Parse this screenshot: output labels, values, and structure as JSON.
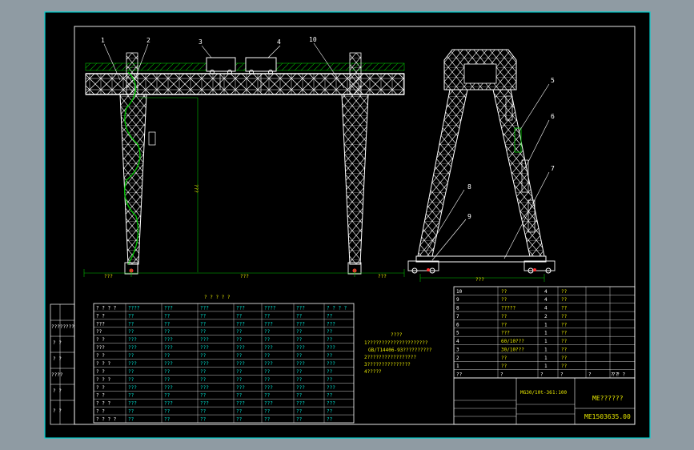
{
  "drawing": {
    "balloons_front": [
      "1",
      "2",
      "3",
      "4",
      "10"
    ],
    "balloons_side": [
      "5",
      "6",
      "7",
      "8",
      "9"
    ],
    "dims_front": [
      "???",
      "???",
      "???",
      "???"
    ],
    "dim_side": "???",
    "table_title": "? ? ? ? ?",
    "notes_title": "????",
    "notes_lines": [
      "1?????????????????????",
      "GB/T14406-93??????????",
      "2?????????????????",
      "3???????????????",
      "4?????"
    ],
    "left_margin_labels": [
      "????????",
      "? ?",
      "? ?",
      "????",
      "? ?",
      "? ?"
    ],
    "spec_rows": [
      [
        "? ? ? ?",
        "????",
        "???",
        "???",
        "???",
        "????",
        "???",
        "? ? ? ?"
      ],
      [
        "? ?",
        "??",
        "??",
        "??",
        "??",
        "??",
        "??",
        "??"
      ],
      [
        "???",
        "??",
        "??",
        "??",
        "???",
        "???",
        "???",
        "???"
      ],
      [
        "??",
        "??",
        "??",
        "??",
        "??",
        "??",
        "??",
        "??"
      ],
      [
        "? ?",
        "???",
        "???",
        "???",
        "??",
        "??",
        "??",
        "??"
      ],
      [
        "???",
        "???",
        "???",
        "???",
        "???",
        "???",
        "???",
        "???"
      ],
      [
        "? ?",
        "??",
        "??",
        "??",
        "??",
        "??",
        "??",
        "??"
      ],
      [
        "? ? ?",
        "???",
        "???",
        "???",
        "???",
        "???",
        "???",
        "???"
      ],
      [
        "? ?",
        "??",
        "??",
        "??",
        "??",
        "??",
        "??",
        "??"
      ],
      [
        "? ? ?",
        "??",
        "??",
        "??",
        "??",
        "??",
        "??",
        "??"
      ],
      [
        "? ?",
        "???",
        "???",
        "???",
        "???",
        "???",
        "???",
        "???"
      ],
      [
        "? ?",
        "??",
        "??",
        "??",
        "??",
        "??",
        "??",
        "??"
      ],
      [
        "? ? ?",
        "???",
        "???",
        "???",
        "???",
        "???",
        "???",
        "???"
      ],
      [
        "? ?",
        "??",
        "??",
        "??",
        "??",
        "??",
        "??",
        "??"
      ],
      [
        "? ? ? ?",
        "??",
        "??",
        "??",
        "??",
        "??",
        "??",
        "??"
      ]
    ],
    "parts_list": [
      {
        "no": "10",
        "name": "??",
        "qty": "4",
        "mat": "??"
      },
      {
        "no": "9",
        "name": "??",
        "qty": "4",
        "mat": "??"
      },
      {
        "no": "8",
        "name": "?????",
        "qty": "4",
        "mat": "??"
      },
      {
        "no": "7",
        "name": "??",
        "qty": "2",
        "mat": "??"
      },
      {
        "no": "6",
        "name": "??",
        "qty": "1",
        "mat": "??"
      },
      {
        "no": "5",
        "name": "???",
        "qty": "1",
        "mat": "??"
      },
      {
        "no": "4",
        "name": "60/10???",
        "qty": "1",
        "mat": "??"
      },
      {
        "no": "3",
        "name": "30/10???",
        "qty": "1",
        "mat": "??"
      },
      {
        "no": "2",
        "name": "??",
        "qty": "1",
        "mat": "??"
      },
      {
        "no": "1",
        "name": "??",
        "qty": "1",
        "mat": "??"
      }
    ],
    "parts_header": [
      "??",
      "?",
      "?",
      "?",
      "?",
      "??",
      "? ? ?"
    ],
    "title_block": {
      "name": "ME??????",
      "number": "ME1503635.00",
      "spec": "MG30/10t-36",
      "scale": "1:100"
    }
  }
}
